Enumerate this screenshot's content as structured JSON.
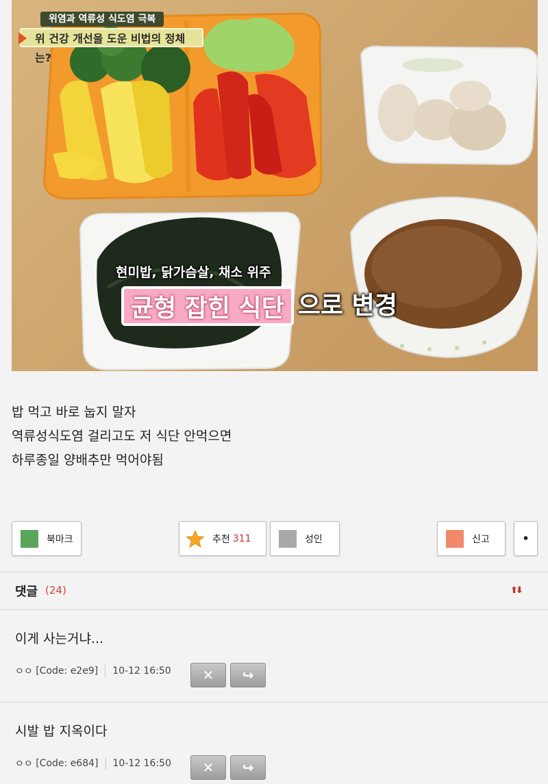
{
  "photo": {
    "banner_line1": "위염과 역류성 식도염 극복",
    "banner_line2": "위 건강 개선을 도운 비법의 정체는?",
    "caption_small": "현미밥, 닭가슴살, 채소 위주",
    "caption_highlight": "균형 잡힌 식단",
    "caption_rest": "으로 변경"
  },
  "post": {
    "lines": [
      "밥 먹고 바로 눕지 말자",
      "역류성식도염 걸리고도 저 식단 안먹으면",
      "하루종일 양배추만 먹어야됨"
    ]
  },
  "actions": {
    "bookmark_label": "북마크",
    "recommend_label": "추천",
    "recommend_count": "311",
    "adult_label": "성인",
    "report_label": "신고",
    "more_label": "•",
    "bookmark_color": "#5aa55a",
    "recommend_color": "#f5a623",
    "adult_color": "#a9a9a9",
    "report_color": "#f08a6a"
  },
  "comments": {
    "title": "댓글",
    "count": "(24)",
    "sort_icon": "sort-arrows-icon",
    "items": [
      {
        "text": "이게 사는거냐...",
        "author": "ㅇㅇ",
        "code": "[Code: e2e9]",
        "time": "10-12 16:50",
        "delete_icon": "✕",
        "reply_icon": "↪"
      },
      {
        "text": "시발 밥 지옥이다",
        "author": "ㅇㅇ",
        "code": "[Code: e684]",
        "time": "10-12 16:50",
        "delete_icon": "✕",
        "reply_icon": "↪"
      }
    ]
  }
}
